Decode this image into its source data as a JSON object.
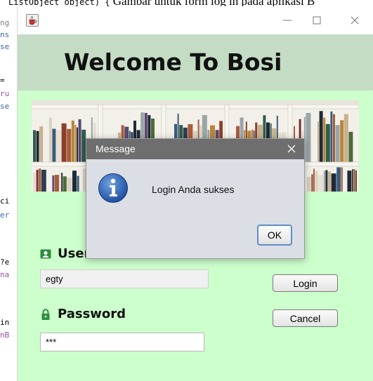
{
  "background_editor": {
    "caption": "Gambar untuk form log in pada aplikasi B",
    "caption_code": "ListObject object) {",
    "lines": [
      {
        "text": "ng",
        "color": "#808080"
      },
      {
        "text": "ns",
        "color": "#3a66a8"
      },
      {
        "text": "se",
        "color": "#3a66a8"
      },
      {
        "text": " =",
        "color": "#000000"
      },
      {
        "text": "ru",
        "color": "#9b4ea8"
      },
      {
        "text": "se",
        "color": "#3a66a8"
      },
      {
        "text": "ci",
        "color": "#000000"
      },
      {
        "text": "er",
        "color": "#3a66a8"
      },
      {
        "text": "?e",
        "color": "#000000"
      },
      {
        "text": "na",
        "color": "#9b4ea8"
      },
      {
        "text": "in",
        "color": "#000000"
      },
      {
        "text": "nB",
        "color": "#9b4ea8"
      }
    ]
  },
  "window": {
    "app_icon": "java-cup-icon",
    "controls": [
      "minimize-icon",
      "maximize-icon",
      "close-icon"
    ],
    "header_title": "Welcome To Bosi",
    "header_band_color": "#c4dcc4",
    "content_bg_color": "#ccffcc"
  },
  "login_form": {
    "username_label": "Username",
    "username_value": "egty",
    "password_label": "Password",
    "password_value": "***",
    "login_button": "Login",
    "cancel_button": "Cancel",
    "user_icon": "user-card-icon",
    "lock_icon": "lock-icon",
    "icon_color": "#2e8b3e"
  },
  "dialog": {
    "title": "Message",
    "message": "Login Anda sukses",
    "ok_button": "OK",
    "icon": "info-icon",
    "titlebar_color": "#6e6e6e",
    "body_color": "#dcdee6"
  }
}
